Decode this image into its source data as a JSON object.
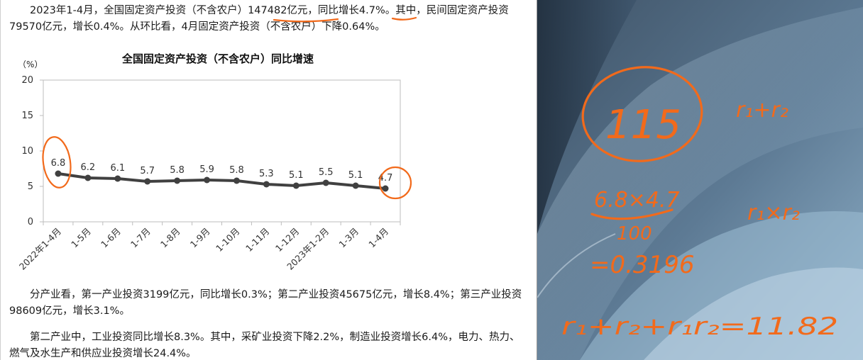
{
  "document": {
    "paragraphs": [
      "2023年1-4月，全国固定资产投资（不含农户）147482亿元，同比增长4.7%。其中，民间固定资产投资79570亿元，增长0.4%。从环比看，4月固定资产投资（不含农户）下降0.64%。",
      "分产业看，第一产业投资3199亿元，同比增长0.3%；第二产业投资45675亿元，增长8.4%；第三产业投资98609亿元，增长3.1%。",
      "第二产业中，工业投资同比增长8.3%。其中，采矿业投资下降2.2%，制造业投资增长6.4%，电力、热力、燃气及水生产和供应业投资增长24.4%。"
    ]
  },
  "chart_data": {
    "type": "line",
    "title": "全国固定资产投资（不含农户）同比增速",
    "ylabel": "（%）",
    "ylim": [
      0,
      20
    ],
    "yticks": [
      "0",
      "5",
      "10",
      "15",
      "20"
    ],
    "categories": [
      "2022年1-4月",
      "1-5月",
      "1-6月",
      "1-7月",
      "1-8月",
      "1-9月",
      "1-10月",
      "1-11月",
      "1-12月",
      "2023年1-2月",
      "1-3月",
      "1-4月"
    ],
    "values": [
      6.8,
      6.2,
      6.1,
      5.7,
      5.8,
      5.9,
      5.8,
      5.3,
      5.1,
      5.5,
      5.1,
      4.7
    ],
    "data_labels": [
      "6.8",
      "6.2",
      "6.1",
      "5.7",
      "5.8",
      "5.9",
      "5.8",
      "5.3",
      "5.1",
      "5.5",
      "5.1",
      "4.7"
    ],
    "grid": false,
    "line_color": "#404040"
  },
  "annotations": {
    "ink_color": "#f26a1b",
    "notes": [
      "115",
      "r₁+r₂",
      "6.8×4.7",
      "100",
      "=0.3196",
      "r₁×r₂",
      "r₁+r₂+r₁r₂=11.82"
    ]
  }
}
